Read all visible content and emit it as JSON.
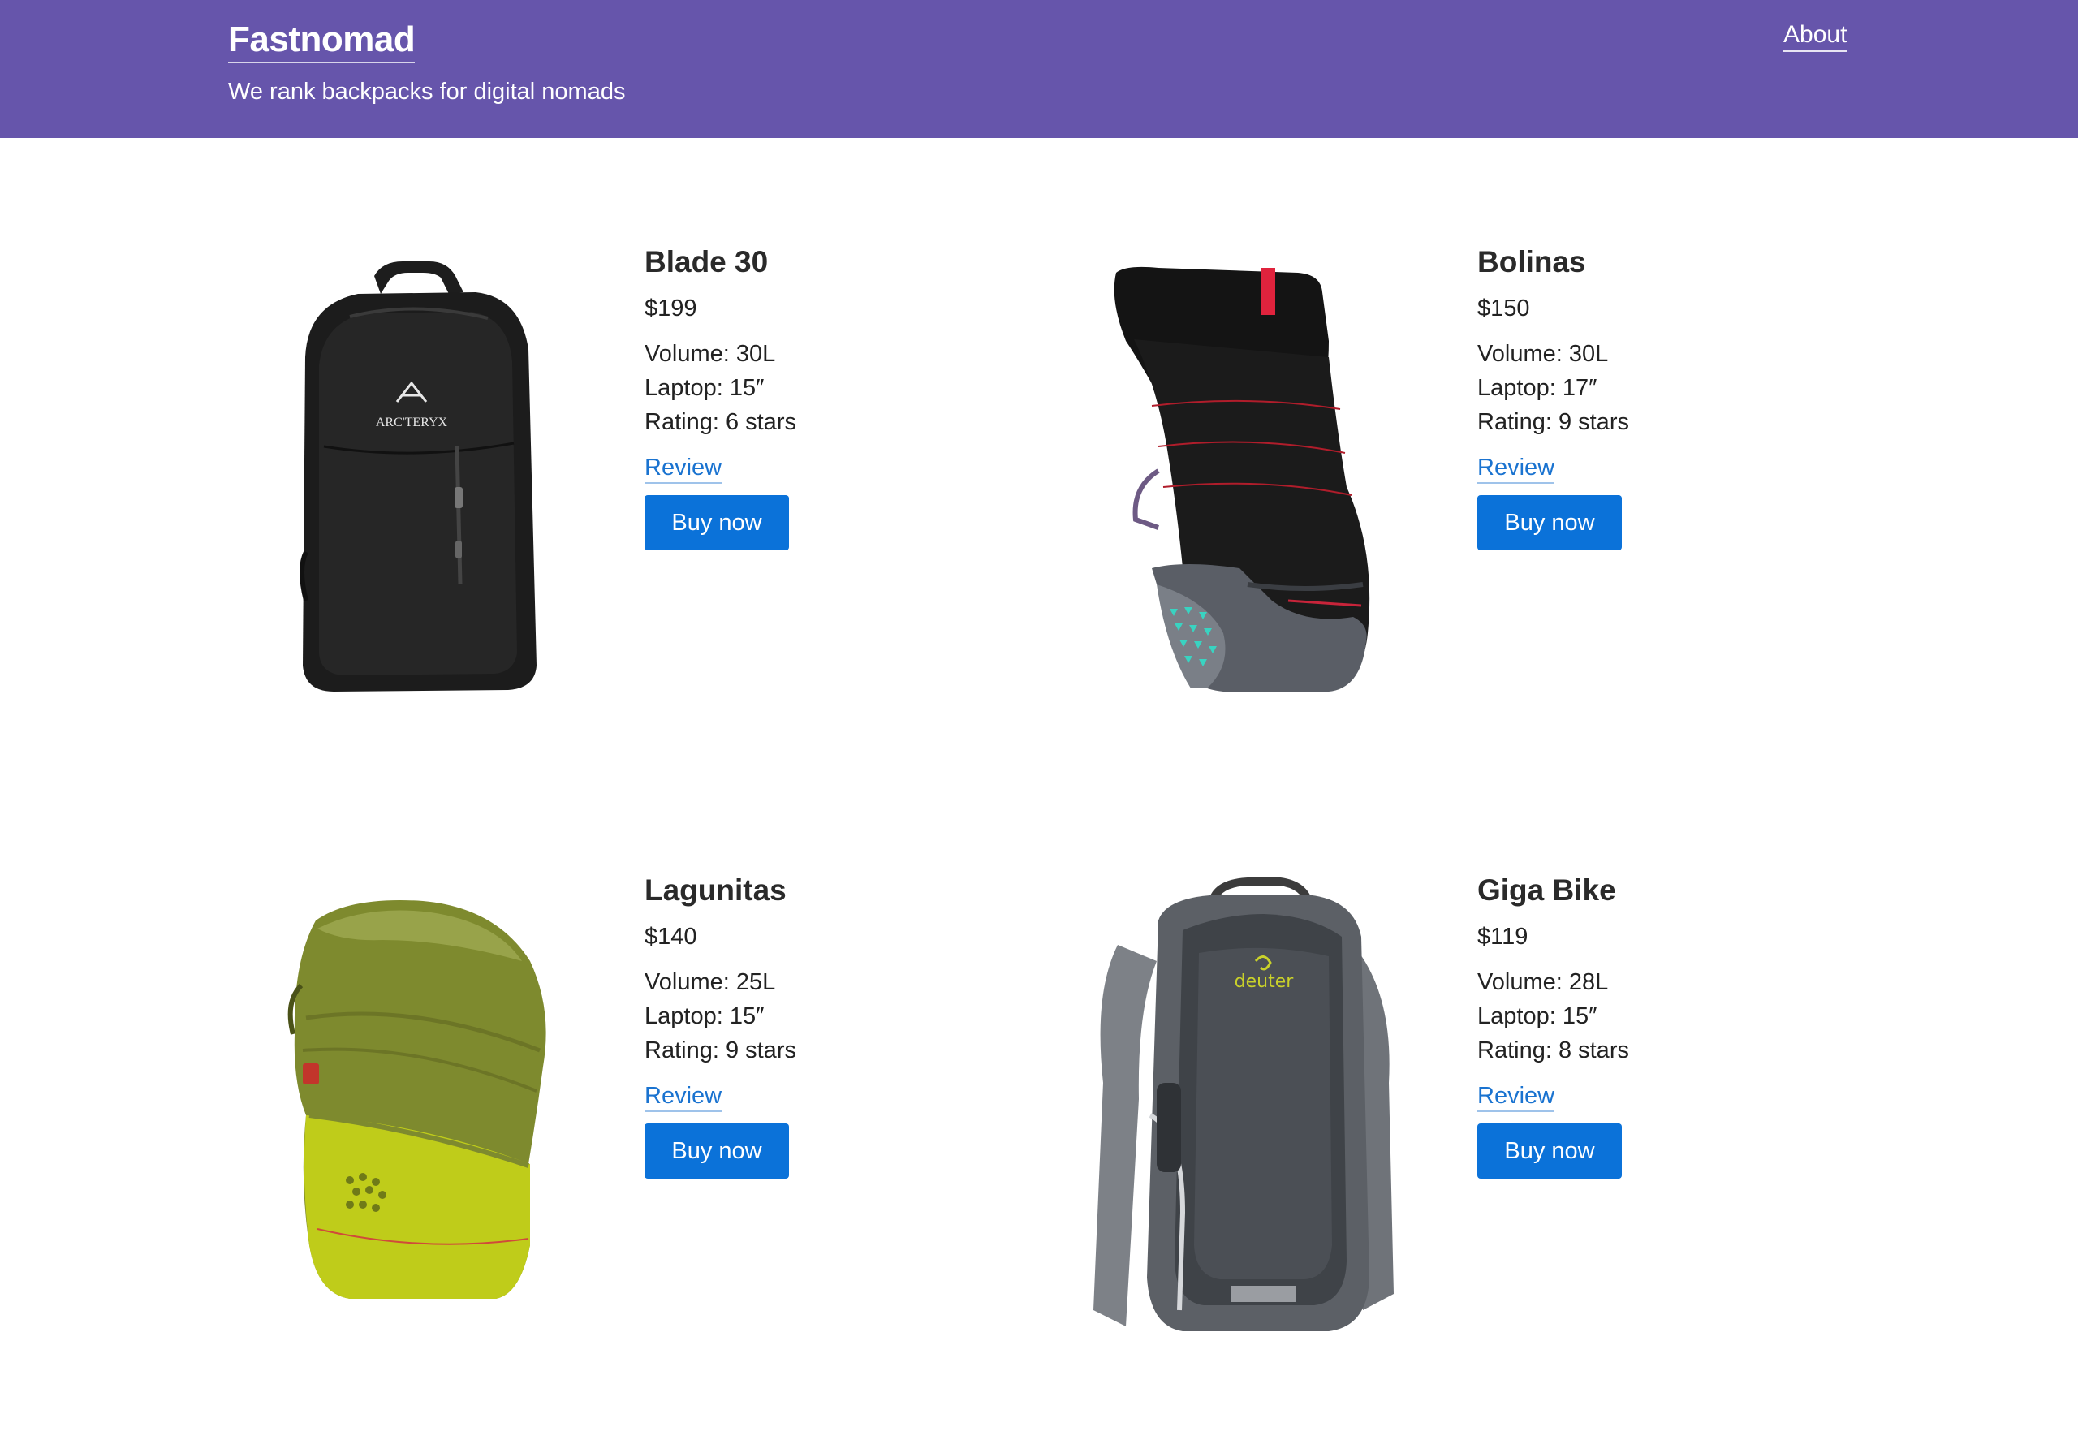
{
  "header": {
    "brand": "Fastnomad",
    "tagline": "We rank backpacks for digital nomads",
    "nav_about": "About",
    "background_color": "#6655ab"
  },
  "products": [
    {
      "name": "Blade 30",
      "price": "$199",
      "volume": "Volume: 30L",
      "laptop": "Laptop: 15″",
      "rating": "Rating: 6 stars",
      "review_label": "Review",
      "buy_label": "Buy now",
      "image_brand": "ARC'TERYX"
    },
    {
      "name": "Bolinas",
      "price": "$150",
      "volume": "Volume: 30L",
      "laptop": "Laptop: 17″",
      "rating": "Rating: 9 stars",
      "review_label": "Review",
      "buy_label": "Buy now"
    },
    {
      "name": "Lagunitas",
      "price": "$140",
      "volume": "Volume: 25L",
      "laptop": "Laptop: 15″",
      "rating": "Rating: 9 stars",
      "review_label": "Review",
      "buy_label": "Buy now"
    },
    {
      "name": "Giga Bike",
      "price": "$119",
      "volume": "Volume: 28L",
      "laptop": "Laptop: 15″",
      "rating": "Rating: 8 stars",
      "review_label": "Review",
      "buy_label": "Buy now",
      "image_brand": "deuter"
    }
  ],
  "colors": {
    "accent_button": "#0b72d9",
    "link": "#1a73d0"
  }
}
